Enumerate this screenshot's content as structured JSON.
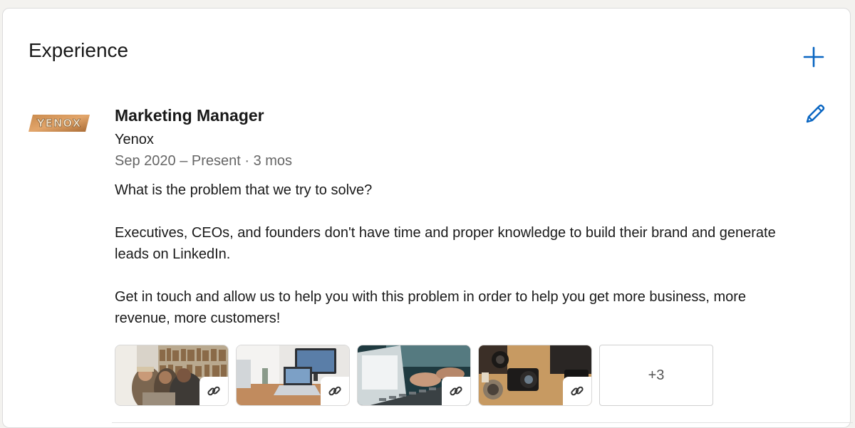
{
  "section": {
    "title": "Experience",
    "add_icon": "plus-icon",
    "edit_icon": "pencil-icon",
    "accent_color": "#0a66c2"
  },
  "experience": {
    "logo_text": "YENOX",
    "title": "Marketing Manager",
    "company": "Yenox",
    "dates": "Sep 2020 – Present · 3 mos",
    "description": [
      "What is the problem that we try to solve?",
      "Executives, CEOs, and founders don't have time and proper knowledge to build their brand and generate leads on LinkedIn.",
      "Get in touch and allow us to help you with this problem in order to help you get more business, more revenue, more customers!"
    ],
    "media": [
      {
        "icon": "link-icon",
        "subject": "people-at-laptop-library"
      },
      {
        "icon": "link-icon",
        "subject": "desk-with-laptop"
      },
      {
        "icon": "link-icon",
        "subject": "hands-typing-laptop"
      },
      {
        "icon": "link-icon",
        "subject": "camera-gear"
      }
    ],
    "more_label": "+3"
  }
}
